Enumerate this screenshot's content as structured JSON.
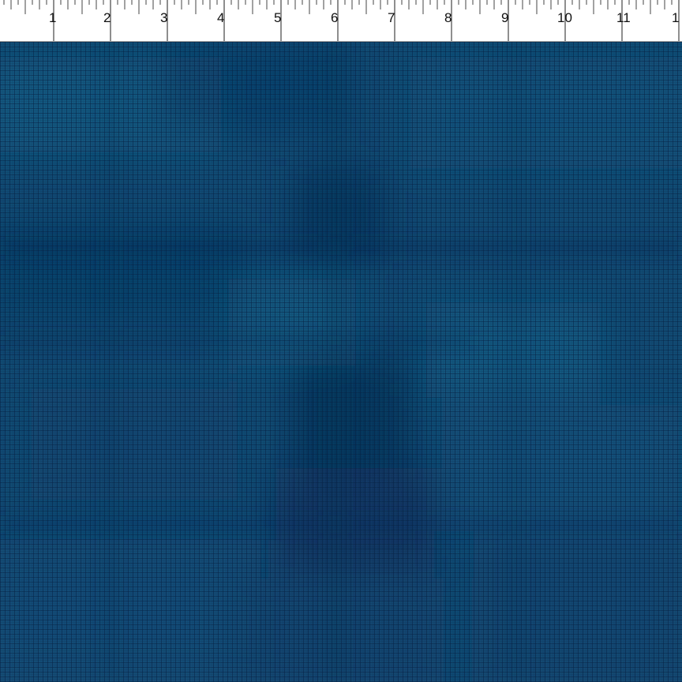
{
  "ruler": {
    "labels": [
      "1",
      "2",
      "3",
      "4",
      "5",
      "6",
      "7",
      "8",
      "9",
      "10",
      "11",
      "1"
    ]
  },
  "fabric": {
    "description_color_base": "#114a73",
    "palette": [
      "#0b3b66",
      "#0e4470",
      "#13557e",
      "#1a6389",
      "#082d55",
      "#0a2a5a"
    ]
  }
}
